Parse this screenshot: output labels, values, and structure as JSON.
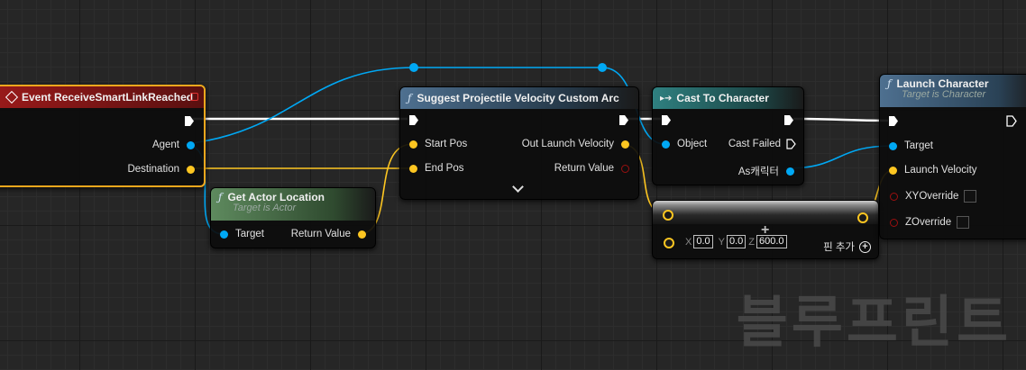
{
  "colors": {
    "exec": "#ffffff",
    "object": "#00a8f4",
    "vector": "#fdc621",
    "bool": "#940b0b",
    "event_header": "#8b1414",
    "func_header": "#4a6c88",
    "cast_header": "#2e7a7a",
    "actor_loc_header": "#557a55",
    "selection": "#f1a71d"
  },
  "event_node": {
    "title": "Event ReceiveSmartLinkReached",
    "icon": "event-diamond-icon",
    "pins": {
      "agent": "Agent",
      "destination": "Destination"
    }
  },
  "suggest_node": {
    "title": "Suggest Projectile Velocity Custom Arc",
    "pins": {
      "start_pos": "Start Pos",
      "end_pos": "End Pos",
      "out_launch_velocity": "Out Launch Velocity",
      "return_value": "Return Value"
    },
    "expand_icon": "chevron-down-icon"
  },
  "get_actor_node": {
    "title": "Get Actor Location",
    "subtitle": "Target is Actor",
    "pins": {
      "target": "Target",
      "return_value": "Return Value"
    }
  },
  "cast_node": {
    "title": "Cast To Character",
    "pins": {
      "object": "Object",
      "cast_failed": "Cast Failed",
      "as_character": "As캐릭터"
    }
  },
  "make_vector_node": {
    "x_label": "X",
    "x_value": "0.0",
    "y_label": "Y",
    "y_value": "0.0",
    "z_label": "Z",
    "z_value": "600.0",
    "add_pin_label": "핀 추가",
    "add_pin_icon": "plus-circle-icon"
  },
  "launch_node": {
    "title": "Launch Character",
    "subtitle": "Target is Character",
    "pins": {
      "target": "Target",
      "launch_velocity": "Launch Velocity",
      "xy_override": "XYOverride",
      "z_override": "ZOverride"
    }
  },
  "watermark": "블루프린트"
}
